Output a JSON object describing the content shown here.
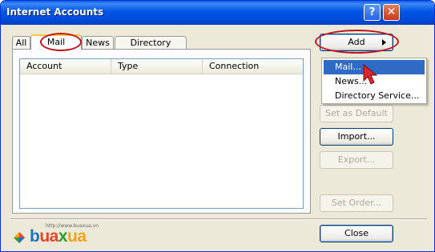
{
  "window": {
    "title": "Internet Accounts",
    "help_label": "?",
    "close_label": "✕"
  },
  "tabs": [
    {
      "label": "All"
    },
    {
      "label": "Mail"
    },
    {
      "label": "News"
    },
    {
      "label": "Directory Service"
    }
  ],
  "list": {
    "columns": [
      "Account",
      "Type",
      "Connection"
    ]
  },
  "buttons": {
    "add": "Add",
    "set_default": "Set as Default",
    "import": "Import...",
    "export": "Export...",
    "set_order": "Set Order...",
    "close": "Close"
  },
  "add_menu": {
    "items": [
      "Mail...",
      "News...",
      "Directory Service..."
    ],
    "highlighted": "Mail..."
  },
  "watermark": {
    "url": "http://www.buaxua.vn",
    "brand": [
      "b",
      "ua",
      "x",
      "ua"
    ]
  },
  "colors": {
    "titlebar": "#0055e5",
    "highlight_oval": "#c0161b",
    "menu_highlight": "#316ac5"
  }
}
